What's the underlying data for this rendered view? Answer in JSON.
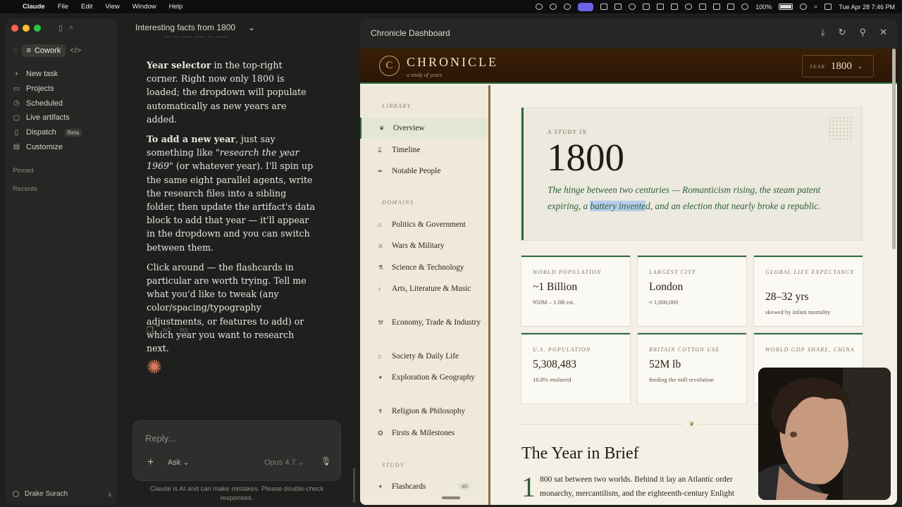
{
  "menubar": {
    "app": "Claude",
    "items": [
      "File",
      "Edit",
      "View",
      "Window",
      "Help"
    ],
    "battery": "100%",
    "datetime": "Tue Apr 28  7:46 PM"
  },
  "sidebar": {
    "mode": "Cowork",
    "nav": [
      {
        "label": "New task",
        "icon": "plus-icon"
      },
      {
        "label": "Projects",
        "icon": "folder-icon"
      },
      {
        "label": "Scheduled",
        "icon": "clock-icon"
      },
      {
        "label": "Live artifacts",
        "icon": "artifact-icon"
      },
      {
        "label": "Dispatch",
        "icon": "dispatch-icon",
        "badge": "Beta"
      },
      {
        "label": "Customize",
        "icon": "customize-icon"
      }
    ],
    "pinned": "Pinned",
    "recents": "Recents",
    "user": "Drake Surach"
  },
  "chat": {
    "title": "Interesting facts from 1800",
    "cut_line": "... ... ...... ...... ... ......",
    "p1_bold": "Year selector",
    "p1_rest": " in the top-right corner. Right now only 1800 is loaded; the dropdown will populate automatically as new years are added.",
    "p2_bold": "To add a new year",
    "p2_mid": ", just say something like ",
    "p2_italic": "\"research the year 1969\"",
    "p2_rest": " (or whatever year). I'll spin up the same eight parallel agents, write the research files into a sibling folder, then update the artifact's data block to add that year — it'll appear in the dropdown and you can switch between them.",
    "p3": "Click around — the flashcards in particular are worth trying. Tell me what you'd like to tweak (any color/spacing/typography adjustments, or features to add) or which year you want to research next.",
    "reply_placeholder": "Reply...",
    "mode": "Ask",
    "model": "Opus 4.7",
    "disclaimer": "Claude is AI and can make mistakes. Please double-check responses."
  },
  "artifact": {
    "title": "Chronicle Dashboard",
    "brand": "CHRONICLE",
    "logo": "C",
    "tagline": "a study of years",
    "year_label": "YEAR",
    "year_value": "1800",
    "library_hd": "LIBRARY",
    "domains_hd": "DOMAINS",
    "study_hd": "STUDY",
    "library": [
      {
        "label": "Overview",
        "active": true
      },
      {
        "label": "Timeline"
      },
      {
        "label": "Notable People"
      }
    ],
    "domains": [
      "Politics & Government",
      "Wars & Military",
      "Science & Technology",
      "Arts, Literature & Music",
      "Economy, Trade & Industry",
      "Society & Daily Life",
      "Exploration & Geography",
      "Religion & Philosophy",
      "Firsts & Milestones"
    ],
    "study": [
      {
        "label": "Flashcards",
        "count": "40"
      }
    ],
    "hero": {
      "pre": "A STUDY IN",
      "year": "1800",
      "summary_a": "The hinge between two centuries — Romanticism rising, the steam patent expiring, a ",
      "summary_hl": "battery invente",
      "summary_b": "d, and an election that nearly broke a republic."
    },
    "cards": [
      {
        "label": "WORLD POPULATION",
        "value": "~1 Billion",
        "sub": "950M – 1.0B est."
      },
      {
        "label": "LARGEST CITY",
        "value": "London",
        "sub": "≈ 1,000,000"
      },
      {
        "label": "GLOBAL LIFE EXPECTANCY",
        "value": "28–32 yrs",
        "sub": "skewed by infant mortality"
      },
      {
        "label": "U.S. POPULATION",
        "value": "5,308,483",
        "sub": "16.8% enslaved"
      },
      {
        "label": "BRITAIN COTTON USE",
        "value": "52M lb",
        "sub": "feeding the mill revolution"
      },
      {
        "label": "WORLD GDP SHARE, CHINA",
        "value": "",
        "sub": ""
      }
    ],
    "brief_title": "The Year in Brief",
    "dropcap": "1",
    "brief_l1": "800 sat between two worlds. Behind it lay an Atlantic order",
    "brief_l2": "monarchy, mercantilism, and the eighteenth-century Enlight"
  }
}
